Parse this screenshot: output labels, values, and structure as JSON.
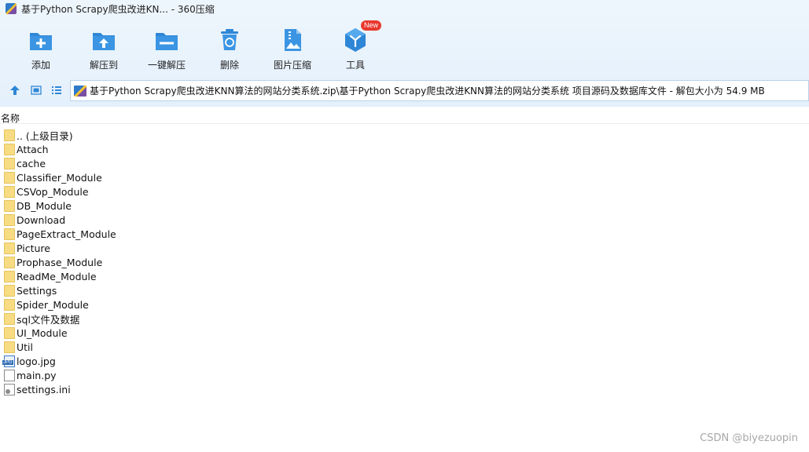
{
  "window": {
    "title": "基于Python Scrapy爬虫改进KN... - 360压缩"
  },
  "toolbar": {
    "items": [
      {
        "label": "添加",
        "icon": "add-icon"
      },
      {
        "label": "解压到",
        "icon": "extract-to-icon"
      },
      {
        "label": "一键解压",
        "icon": "one-click-extract-icon"
      },
      {
        "label": "删除",
        "icon": "delete-icon"
      },
      {
        "label": "图片压缩",
        "icon": "image-compress-icon"
      },
      {
        "label": "工具",
        "icon": "tools-icon",
        "badge": "New"
      }
    ]
  },
  "address": {
    "path": "基于Python Scrapy爬虫改进KNN算法的网站分类系统.zip\\基于Python Scrapy爬虫改进KNN算法的网站分类系统 项目源码及数据库文件 - 解包大小为 54.9 MB"
  },
  "list": {
    "header": "名称",
    "items": [
      {
        "name": ".. (上级目录)",
        "type": "folder"
      },
      {
        "name": "Attach",
        "type": "folder"
      },
      {
        "name": "cache",
        "type": "folder"
      },
      {
        "name": "Classifier_Module",
        "type": "folder"
      },
      {
        "name": "CSVop_Module",
        "type": "folder"
      },
      {
        "name": "DB_Module",
        "type": "folder"
      },
      {
        "name": "Download",
        "type": "folder"
      },
      {
        "name": "PageExtract_Module",
        "type": "folder"
      },
      {
        "name": "Picture",
        "type": "folder"
      },
      {
        "name": "Prophase_Module",
        "type": "folder"
      },
      {
        "name": "ReadMe_Module",
        "type": "folder"
      },
      {
        "name": "Settings",
        "type": "folder"
      },
      {
        "name": "Spider_Module",
        "type": "folder"
      },
      {
        "name": "sql文件及数据",
        "type": "folder"
      },
      {
        "name": "UI_Module",
        "type": "folder"
      },
      {
        "name": "Util",
        "type": "folder"
      },
      {
        "name": "logo.jpg",
        "type": "jpg"
      },
      {
        "name": "main.py",
        "type": "py"
      },
      {
        "name": "settings.ini",
        "type": "ini"
      }
    ]
  },
  "watermark": "CSDN @biyezuopin",
  "colors": {
    "accent": "#2e86d6",
    "toolbar_bg": "#e8f2fc",
    "folder": "#f8dc84",
    "badge": "#e8382f"
  }
}
